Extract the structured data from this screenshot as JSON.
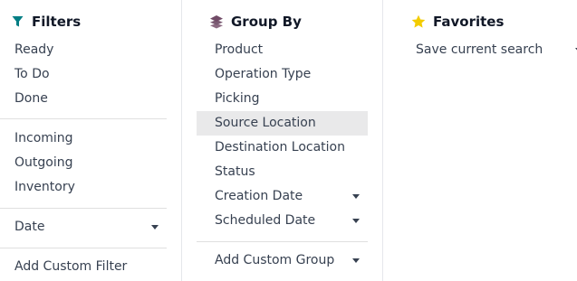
{
  "filters": {
    "title": "Filters",
    "icon": "filter-icon",
    "icon_color": "#017e84",
    "items": [
      {
        "label": "Ready"
      },
      {
        "label": "To Do"
      },
      {
        "label": "Done"
      },
      {
        "label": "Incoming"
      },
      {
        "label": "Outgoing"
      },
      {
        "label": "Inventory"
      },
      {
        "label": "Date"
      },
      {
        "label": "Add Custom Filter"
      }
    ]
  },
  "group_by": {
    "title": "Group By",
    "icon": "layers-icon",
    "icon_color": "#714B67",
    "items": [
      {
        "label": "Product"
      },
      {
        "label": "Operation Type"
      },
      {
        "label": "Picking"
      },
      {
        "label": "Source Location",
        "active": true
      },
      {
        "label": "Destination Location"
      },
      {
        "label": "Status"
      },
      {
        "label": "Creation Date"
      },
      {
        "label": "Scheduled Date"
      },
      {
        "label": "Add Custom Group"
      }
    ]
  },
  "favorites": {
    "title": "Favorites",
    "icon": "star-icon",
    "icon_color": "#f3cc00",
    "items": [
      {
        "label": "Save current search"
      }
    ]
  },
  "colors": {
    "active_bg": "#e9e9ea",
    "text": "#374151"
  }
}
